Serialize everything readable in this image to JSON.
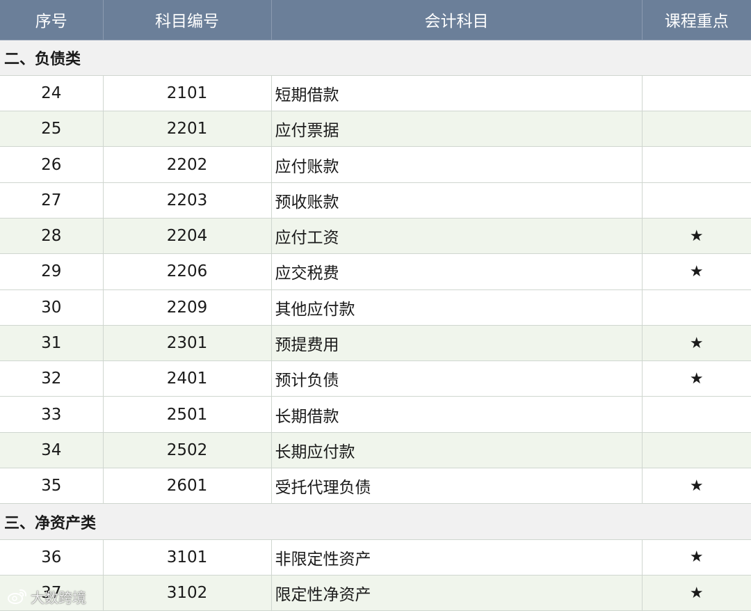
{
  "header": {
    "col_index": "序号",
    "col_code": "科目编号",
    "col_name": "会计科目",
    "col_key": "课程重点"
  },
  "sections": [
    {
      "title": "二、负债类",
      "rows": [
        {
          "index": "24",
          "code": "2101",
          "name": "短期借款",
          "key": ""
        },
        {
          "index": "25",
          "code": "2201",
          "name": "应付票据",
          "key": ""
        },
        {
          "index": "26",
          "code": "2202",
          "name": "应付账款",
          "key": ""
        },
        {
          "index": "27",
          "code": "2203",
          "name": "预收账款",
          "key": ""
        },
        {
          "index": "28",
          "code": "2204",
          "name": "应付工资",
          "key": "★"
        },
        {
          "index": "29",
          "code": "2206",
          "name": "应交税费",
          "key": "★"
        },
        {
          "index": "30",
          "code": "2209",
          "name": "其他应付款",
          "key": ""
        },
        {
          "index": "31",
          "code": "2301",
          "name": "预提费用",
          "key": "★"
        },
        {
          "index": "32",
          "code": "2401",
          "name": "预计负债",
          "key": "★"
        },
        {
          "index": "33",
          "code": "2501",
          "name": "长期借款",
          "key": ""
        },
        {
          "index": "34",
          "code": "2502",
          "name": "长期应付款",
          "key": ""
        },
        {
          "index": "35",
          "code": "2601",
          "name": "受托代理负债",
          "key": "★"
        }
      ]
    },
    {
      "title": "三、净资产类",
      "rows": [
        {
          "index": "36",
          "code": "3101",
          "name": "非限定性资产",
          "key": "★"
        },
        {
          "index": "37",
          "code": "3102",
          "name": "限定性净资产",
          "key": "★"
        }
      ]
    }
  ],
  "watermark": {
    "text": "大数跨境",
    "icon": "weibo-icon"
  },
  "colors": {
    "header_bg": "#6b7f99",
    "section_bg": "#f1f1f1",
    "alt_row_bg": "#f0f5ec"
  }
}
